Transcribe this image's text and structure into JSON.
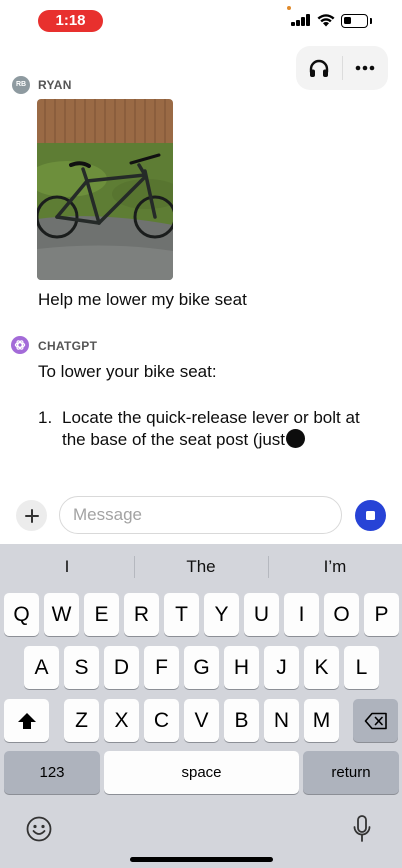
{
  "status_bar": {
    "time": "1:18",
    "battery_level": 0.35
  },
  "header": {
    "icons": [
      "headphones-icon",
      "more-icon"
    ]
  },
  "conversation": {
    "user": {
      "initials": "RB",
      "name": "RYAN",
      "image": "bike-photo",
      "message": "Help me lower my bike seat"
    },
    "assistant": {
      "name": "CHATGPT",
      "intro": "To lower your bike seat:",
      "steps": [
        {
          "number": "1.",
          "text": "Locate the quick-release lever or bolt at the base of the seat post (just"
        }
      ]
    }
  },
  "composer": {
    "placeholder": "Message",
    "value": "",
    "colors": {
      "stop_button": "#2743d6"
    }
  },
  "keyboard": {
    "suggestions": [
      "I",
      "The",
      "I’m"
    ],
    "row1": [
      "Q",
      "W",
      "E",
      "R",
      "T",
      "Y",
      "U",
      "I",
      "O",
      "P"
    ],
    "row2": [
      "A",
      "S",
      "D",
      "F",
      "G",
      "H",
      "J",
      "K",
      "L"
    ],
    "row3": [
      "Z",
      "X",
      "C",
      "V",
      "B",
      "N",
      "M"
    ],
    "numbers_label": "123",
    "space_label": "space",
    "return_label": "return"
  },
  "colors": {
    "time_pill": "#e8302e",
    "keyboard_bg": "#d3d5db"
  }
}
